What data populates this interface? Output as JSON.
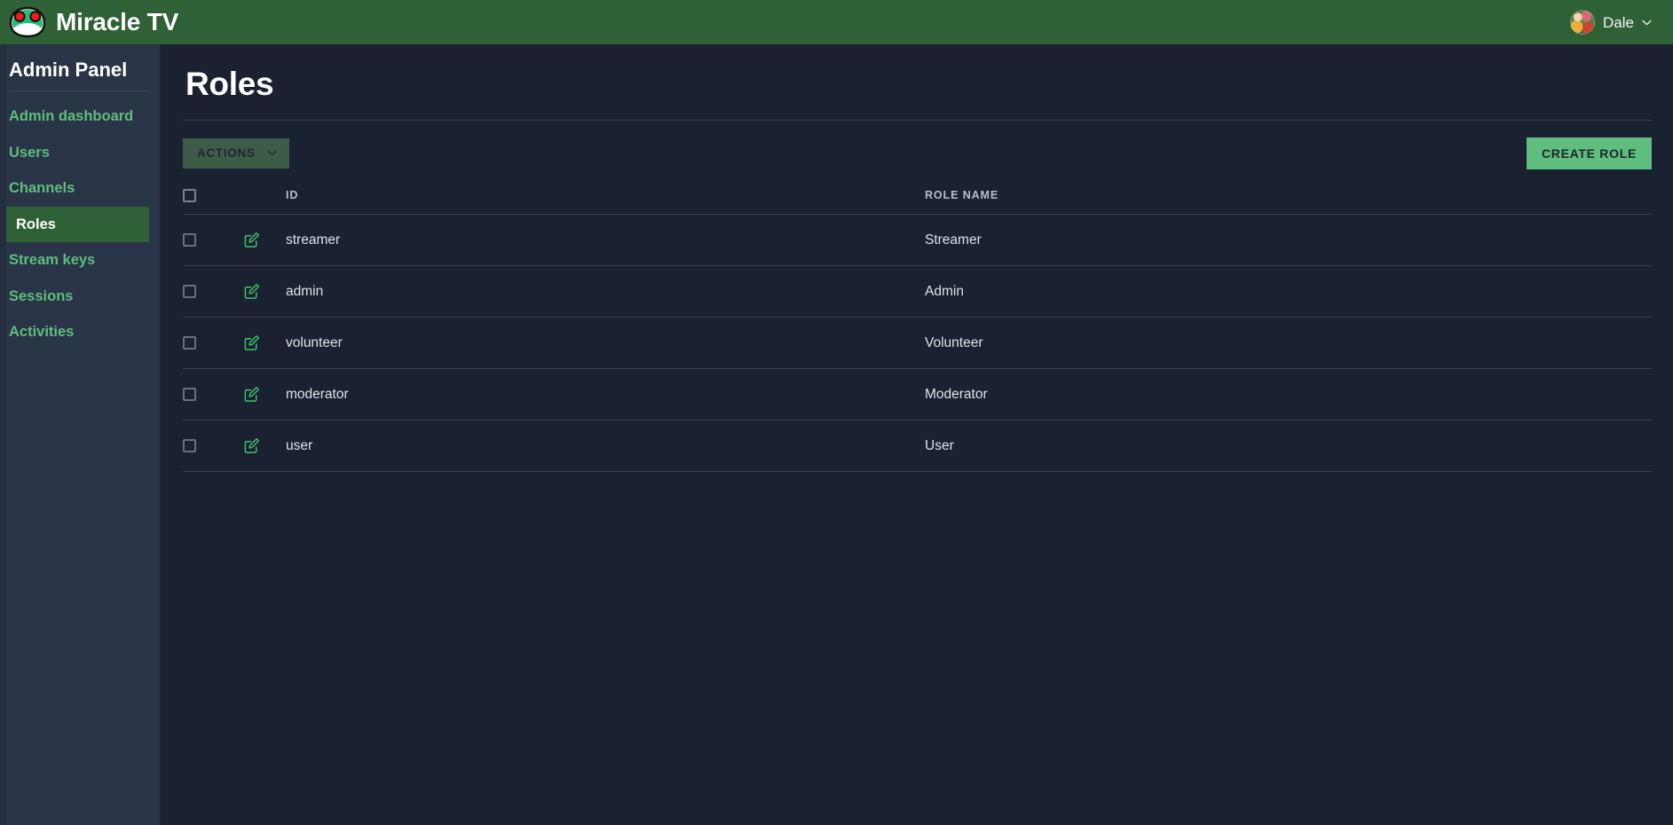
{
  "app": {
    "brand_name": "Miracle TV",
    "logo_icon": "frog-logo-icon",
    "header_color": "#2e6135",
    "accent_color": "#5fbd7e",
    "sidebar_color": "#2a3447",
    "background_color": "#1a2130"
  },
  "user_menu": {
    "name": "Dale",
    "avatar_icon": "avatar",
    "caret_icon": "chevron-down-icon"
  },
  "sidebar": {
    "title": "Admin Panel",
    "items": [
      {
        "label": "Admin dashboard",
        "active": false
      },
      {
        "label": "Users",
        "active": false
      },
      {
        "label": "Channels",
        "active": false
      },
      {
        "label": "Roles",
        "active": true
      },
      {
        "label": "Stream keys",
        "active": false
      },
      {
        "label": "Sessions",
        "active": false
      },
      {
        "label": "Activities",
        "active": false
      }
    ]
  },
  "main": {
    "page_title": "Roles",
    "toolbar": {
      "actions_label": "ACTIONS",
      "actions_caret_icon": "chevron-down-icon",
      "create_label": "CREATE ROLE"
    },
    "table": {
      "columns": [
        "",
        "",
        "ID",
        "ROLE NAME"
      ],
      "select_all_checkbox": false,
      "rows": [
        {
          "checked": false,
          "edit_icon": "edit-pencil-square-icon",
          "id": "streamer",
          "role_name": "Streamer"
        },
        {
          "checked": false,
          "edit_icon": "edit-pencil-square-icon",
          "id": "admin",
          "role_name": "Admin"
        },
        {
          "checked": false,
          "edit_icon": "edit-pencil-square-icon",
          "id": "volunteer",
          "role_name": "Volunteer"
        },
        {
          "checked": false,
          "edit_icon": "edit-pencil-square-icon",
          "id": "moderator",
          "role_name": "Moderator"
        },
        {
          "checked": false,
          "edit_icon": "edit-pencil-square-icon",
          "id": "user",
          "role_name": "User"
        }
      ]
    }
  }
}
